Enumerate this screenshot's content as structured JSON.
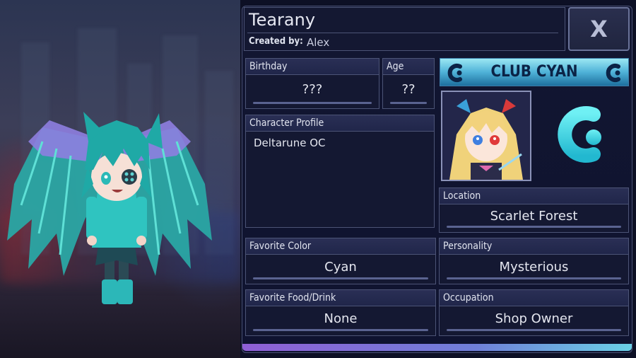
{
  "profile": {
    "name": "Tearany",
    "created_by_label": "Created by:",
    "created_by": "Alex",
    "close_label": "X"
  },
  "fields": {
    "birthday": {
      "label": "Birthday",
      "value": "???"
    },
    "age": {
      "label": "Age",
      "value": "??"
    },
    "character_profile": {
      "label": "Character Profile",
      "value": "Deltarune OC"
    },
    "location": {
      "label": "Location",
      "value": "Scarlet Forest"
    },
    "favorite_color": {
      "label": "Favorite Color",
      "value": "Cyan"
    },
    "personality": {
      "label": "Personality",
      "value": "Mysterious"
    },
    "favorite_food": {
      "label": "Favorite Food/Drink",
      "value": "None"
    },
    "occupation": {
      "label": "Occupation",
      "value": "Shop Owner"
    }
  },
  "club": {
    "banner": "CLUB CYAN",
    "logo_icon": "club-cyan-c-icon"
  },
  "colors": {
    "accent_cyan": "#2fd6e0",
    "panel_bg": "#121631",
    "field_header": "#252b50"
  }
}
